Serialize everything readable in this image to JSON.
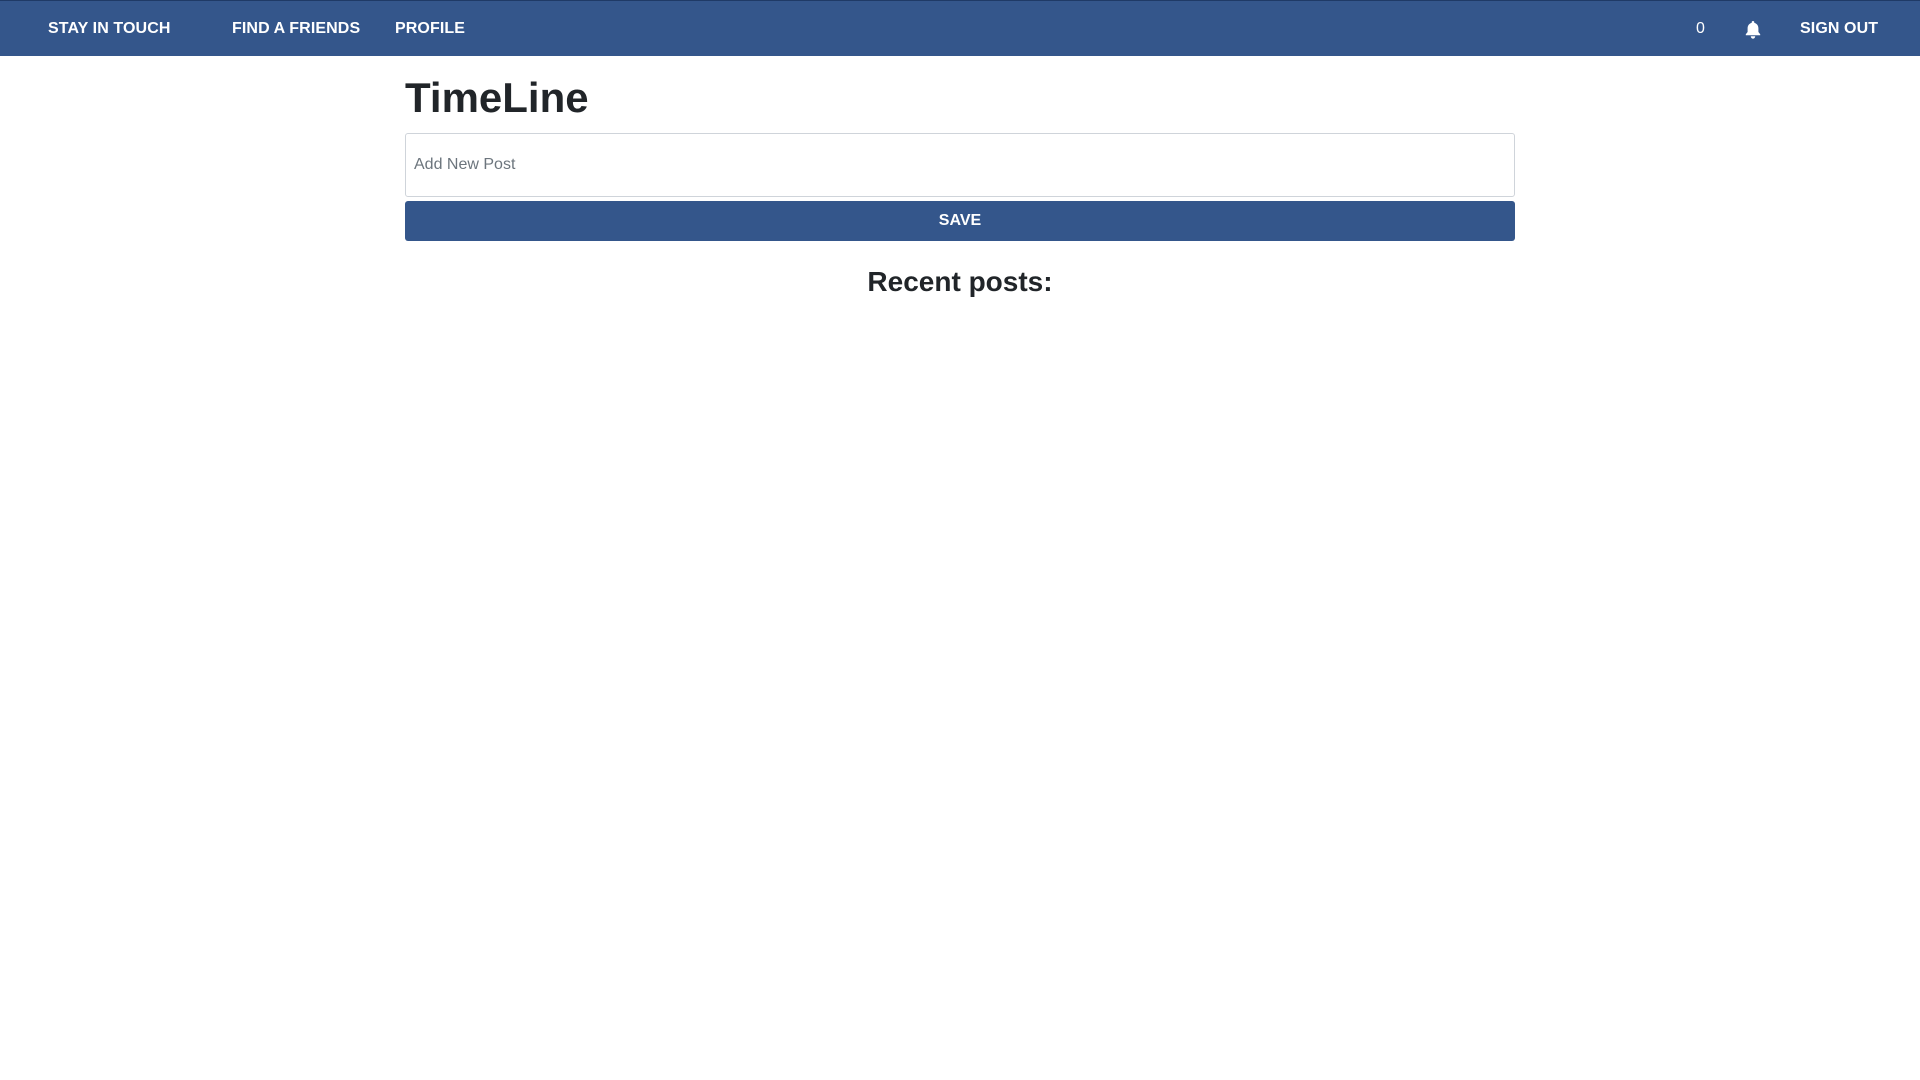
{
  "nav": {
    "brand": "STAY IN TOUCH",
    "find_friends": "FIND A FRIENDS",
    "profile": "PROFILE",
    "notification_count": "0",
    "notification_icon": "bell-icon",
    "sign_out": "SIGN OUT"
  },
  "main": {
    "title": "TimeLine",
    "post_placeholder": "Add New Post",
    "post_value": "",
    "save_label": "SAVE",
    "recent_heading": "Recent posts:"
  },
  "colors": {
    "primary": "#34568b",
    "text": "#212529",
    "background": "#ffffff"
  }
}
